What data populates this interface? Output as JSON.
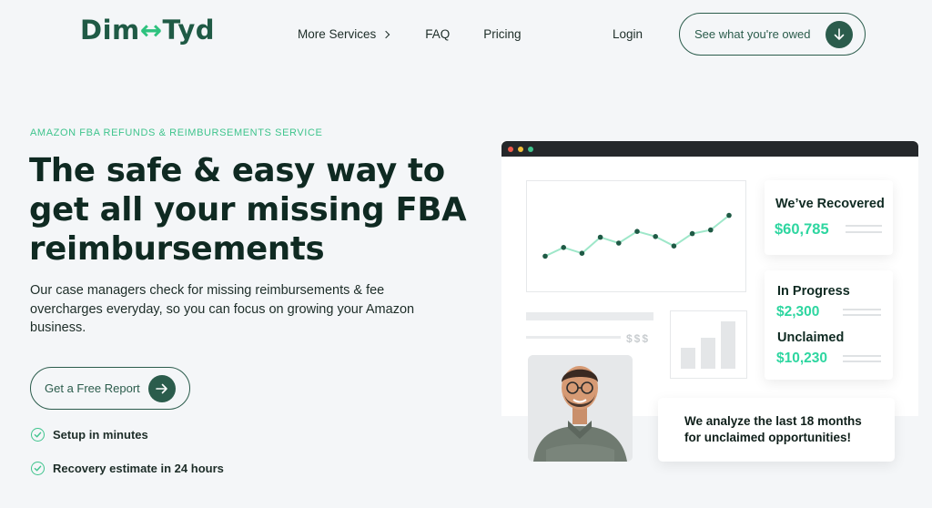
{
  "header": {
    "logo_left": "Dim",
    "logo_mark": "↔",
    "logo_right": "Tyd",
    "nav": {
      "more_services": "More Services",
      "faq": "FAQ",
      "pricing": "Pricing"
    },
    "login": "Login",
    "cta": "See what you're owed"
  },
  "hero": {
    "eyebrow": "AMAZON FBA REFUNDS & REIMBURSEMENTS SERVICE",
    "headline": "The safe & easy way to get all your missing FBA reimbursements",
    "subtext": "Our case managers check for missing reimbursements & fee overcharges everyday, so you can focus on growing your Amazon business.",
    "cta": "Get a Free Report",
    "features": [
      "Setup in minutes",
      "Recovery estimate in 24 hours"
    ]
  },
  "mockup": {
    "dollar_placeholder": "$$$",
    "recovered": {
      "title": "We’ve Recovered",
      "value": "$60,785"
    },
    "in_progress": {
      "title": "In Progress",
      "value": "$2,300"
    },
    "unclaimed": {
      "title": "Unclaimed",
      "value": "$10,230"
    },
    "analyze_text": "We analyze the last 18 months for unclaimed opportunities!",
    "line_chart": [
      0.22,
      0.34,
      0.26,
      0.48,
      0.4,
      0.56,
      0.49,
      0.36,
      0.53,
      0.58,
      0.78
    ]
  },
  "colors": {
    "brand_dark": "#1f5a45",
    "accent_green": "#3fc48d",
    "value_green": "#2ed6a0",
    "button": "#2b5c4c"
  },
  "icons": {
    "nav_chevron": "chevron-right-icon",
    "cta_top": "arrow-down-icon",
    "cta_main": "arrow-right-icon",
    "feature": "check-circle-icon"
  }
}
